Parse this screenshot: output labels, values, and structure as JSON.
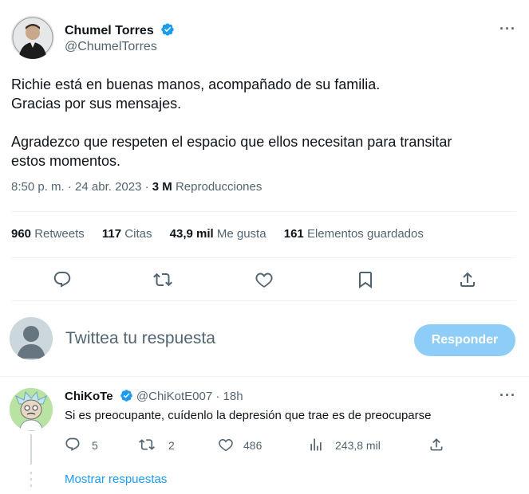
{
  "tweet": {
    "author_name": "Chumel Torres",
    "author_handle": "@ChumelTorres",
    "text_line1": "Richie está en buenas manos, acompañado de su familia.",
    "text_line2": "Gracias por sus mensajes.",
    "text_line3": "Agradezco que respeten el espacio que ellos necesitan para transitar",
    "text_line4": "estos momentos.",
    "time": "8:50 p. m. · 24 abr. 2023 · ",
    "views_count": "3 M",
    "views_label": "Reproducciones",
    "more_label": "···"
  },
  "stats": {
    "retweets_count": "960",
    "retweets_label": "Retweets",
    "quotes_count": "117",
    "quotes_label": "Citas",
    "likes_count": "43,9 mil",
    "likes_label": "Me gusta",
    "bookmarks_count": "161",
    "bookmarks_label": "Elementos guardados"
  },
  "composer": {
    "placeholder": "Twittea tu respuesta",
    "button_label": "Responder"
  },
  "comment": {
    "author_name": "ChiKoTe",
    "author_handle": "@ChiKotE007",
    "time": "· 18h",
    "text": "Si es preocupante, cuídenlo la depresión que trae es de preocuparse",
    "replies": "5",
    "retweets": "2",
    "likes": "486",
    "views": "243,8 mil",
    "more_label": "···",
    "show_replies": "Mostrar respuestas"
  },
  "colors": {
    "accent": "#1d9bf0",
    "button_disabled": "#8ecdf8",
    "secondary_text": "#536471",
    "divider": "#eff3f4"
  }
}
